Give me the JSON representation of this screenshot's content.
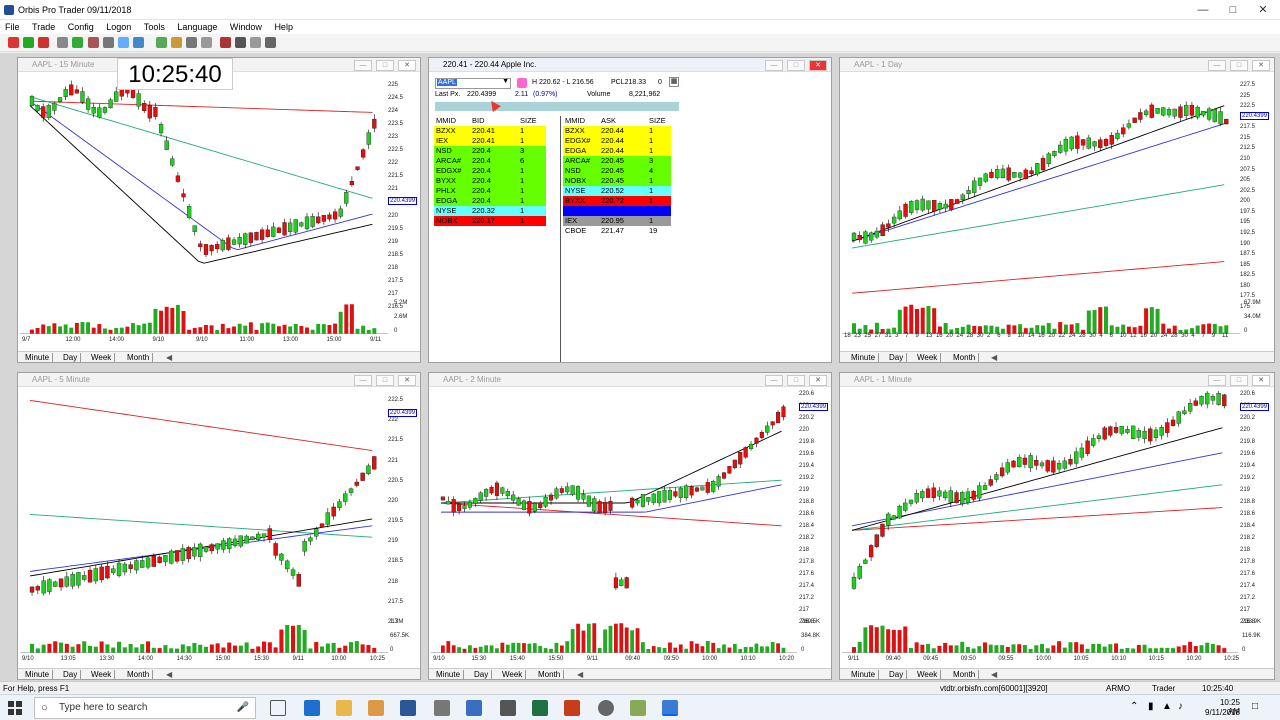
{
  "window": {
    "title": "Orbis Pro Trader 09/11/2018"
  },
  "menu": [
    "File",
    "Trade",
    "Config",
    "Logon",
    "Tools",
    "Language",
    "Window",
    "Help"
  ],
  "clock": "10:25:40",
  "tabs": {
    "minute": "Minute",
    "day": "Day",
    "week": "Week",
    "month": "Month"
  },
  "panels": {
    "p15": {
      "title": "AAPL - 15 Minute",
      "yaxis": [
        "225",
        "224.5",
        "224",
        "223.5",
        "223",
        "222.5",
        "222",
        "221.5",
        "221",
        "220.5",
        "220",
        "219.5",
        "219",
        "218.5",
        "218",
        "217.5",
        "217",
        "216.5"
      ],
      "price_tag": "220.4399",
      "vol_axis": [
        "5.2M",
        "2.6M",
        "0"
      ],
      "xaxis": [
        "9/7",
        "12:00",
        "14:00",
        "9/10",
        "9/10",
        "11:00",
        "13:00",
        "15:00",
        "9/11"
      ]
    },
    "pday": {
      "title": "AAPL - 1 Day",
      "yaxis": [
        "227.5",
        "225",
        "222.5",
        "220",
        "217.5",
        "215",
        "212.5",
        "210",
        "207.5",
        "205",
        "202.5",
        "200",
        "197.5",
        "195",
        "192.5",
        "190",
        "187.5",
        "185",
        "182.5",
        "180",
        "177.5",
        "175"
      ],
      "price_tag": "220.4399",
      "vol_axis": [
        "67.9M",
        "34.0M",
        "0"
      ],
      "xaxis": [
        "18",
        "23",
        "25",
        "27",
        "31",
        "3",
        "7",
        "9",
        "13",
        "16",
        "20",
        "24",
        "28",
        "30",
        "2",
        "6",
        "8",
        "10",
        "14",
        "16",
        "20",
        "22",
        "24",
        "28",
        "30",
        "4",
        "6",
        "10",
        "12",
        "16",
        "20",
        "24",
        "28",
        "30",
        "4",
        "7",
        "9",
        "11"
      ],
      "months": [
        "AUG",
        "SEP"
      ]
    },
    "p5": {
      "title": "AAPL - 5 Minute",
      "yaxis": [
        "222.5",
        "222",
        "221.5",
        "221",
        "220.5",
        "220",
        "219.5",
        "219",
        "218.5",
        "218",
        "217.5",
        "217"
      ],
      "price_tag": "220.4399",
      "vol_axis": [
        "1.3M",
        "667.5K",
        "0"
      ],
      "xaxis": [
        "9/10",
        "13:05",
        "13:30",
        "14:00",
        "14:30",
        "15:00",
        "15:30",
        "9/11",
        "10:00",
        "10:25"
      ]
    },
    "p2": {
      "title": "AAPL - 2 Minute",
      "yaxis": [
        "220.6",
        "220.4",
        "220.2",
        "220",
        "219.8",
        "219.6",
        "219.4",
        "219.2",
        "219",
        "218.8",
        "218.6",
        "218.4",
        "218.2",
        "218",
        "217.8",
        "217.6",
        "217.4",
        "217.2",
        "217",
        "216.8"
      ],
      "price_tag": "220.4399",
      "vol_axis": [
        "769.5K",
        "384.8K",
        "0"
      ],
      "xaxis": [
        "9/10",
        "15:30",
        "15:40",
        "15:50",
        "9/11",
        "09:40",
        "09:50",
        "10:00",
        "10:10",
        "10:20"
      ]
    },
    "p1": {
      "title": "AAPL - 1 Minute",
      "yaxis": [
        "220.6",
        "220.4",
        "220.2",
        "220",
        "219.8",
        "219.6",
        "219.4",
        "219.2",
        "219",
        "218.8",
        "218.6",
        "218.4",
        "218.2",
        "218",
        "217.8",
        "217.6",
        "217.4",
        "217.2",
        "217",
        "216.8"
      ],
      "price_tag": "220.4399",
      "vol_axis": [
        "233.9K",
        "116.9K",
        "0"
      ],
      "xaxis": [
        "9/11",
        "09:40",
        "09:45",
        "09:50",
        "09:55",
        "10:00",
        "10:05",
        "10:10",
        "10:15",
        "10:20",
        "10:25"
      ]
    }
  },
  "level2": {
    "title": "220.41 - 220.44  Apple Inc.",
    "symbol": "AAPL",
    "hl": "H 220.62 - L 216.56",
    "pcl": "PCL218.33",
    "count": "0",
    "last_label": "Last Px.",
    "last": "220.4399",
    "chg": "2.11",
    "pct": "(0.97%)",
    "volume_label": "Volume",
    "volume": "8,221,962",
    "bid_headers": [
      "MMID",
      "BID",
      "SIZE"
    ],
    "ask_headers": [
      "MMID",
      "ASK",
      "SIZE"
    ],
    "bids": [
      {
        "mmid": "BZXX",
        "price": "220.41",
        "size": "1",
        "color": "#ffff00"
      },
      {
        "mmid": "IEX",
        "price": "220.41",
        "size": "1",
        "color": "#ffff00"
      },
      {
        "mmid": "NSD",
        "price": "220.4",
        "size": "3",
        "color": "#66ff00"
      },
      {
        "mmid": "ARCA#",
        "price": "220.4",
        "size": "6",
        "color": "#66ff00"
      },
      {
        "mmid": "EDGX#",
        "price": "220.4",
        "size": "1",
        "color": "#66ff00"
      },
      {
        "mmid": "BYXX",
        "price": "220.4",
        "size": "1",
        "color": "#66ff00"
      },
      {
        "mmid": "PHLX",
        "price": "220.4",
        "size": "1",
        "color": "#66ff00"
      },
      {
        "mmid": "EDGA",
        "price": "220.4",
        "size": "1",
        "color": "#66ff00"
      },
      {
        "mmid": "NYSE",
        "price": "220.32",
        "size": "1",
        "color": "#66ffff"
      },
      {
        "mmid": "NOBX",
        "price": "220.17",
        "size": "1",
        "color": "#ff0000"
      }
    ],
    "asks": [
      {
        "mmid": "BZXX",
        "price": "220.44",
        "size": "1",
        "color": "#ffff00"
      },
      {
        "mmid": "EDGX#",
        "price": "220.44",
        "size": "1",
        "color": "#ffff00"
      },
      {
        "mmid": "EDGA",
        "price": "220.44",
        "size": "1",
        "color": "#ffff00"
      },
      {
        "mmid": "ARCA#",
        "price": "220.45",
        "size": "3",
        "color": "#66ff00"
      },
      {
        "mmid": "NSD",
        "price": "220.45",
        "size": "4",
        "color": "#66ff00"
      },
      {
        "mmid": "NOBX",
        "price": "220.45",
        "size": "1",
        "color": "#66ff00"
      },
      {
        "mmid": "NYSE",
        "price": "220.52",
        "size": "1",
        "color": "#66ffff"
      },
      {
        "mmid": "BYXX",
        "price": "220.72",
        "size": "1",
        "color": "#ff0000"
      },
      {
        "mmid": "",
        "price": "",
        "size": "",
        "color": "#0000ff"
      },
      {
        "mmid": "IEX",
        "price": "220.95",
        "size": "1",
        "color": "#999999"
      },
      {
        "mmid": "CBOE",
        "price": "221.47",
        "size": "19",
        "color": "#ffffff"
      }
    ]
  },
  "statusbar": {
    "help": "For Help, press F1",
    "server": "vtdtr.orbisfn.com[60001][3920]",
    "user": "ARMO",
    "role": "Trader",
    "time": "10:25:40"
  },
  "taskbar": {
    "search_placeholder": "Type here to search",
    "time": "10:25 AM",
    "date": "9/11/2018"
  }
}
